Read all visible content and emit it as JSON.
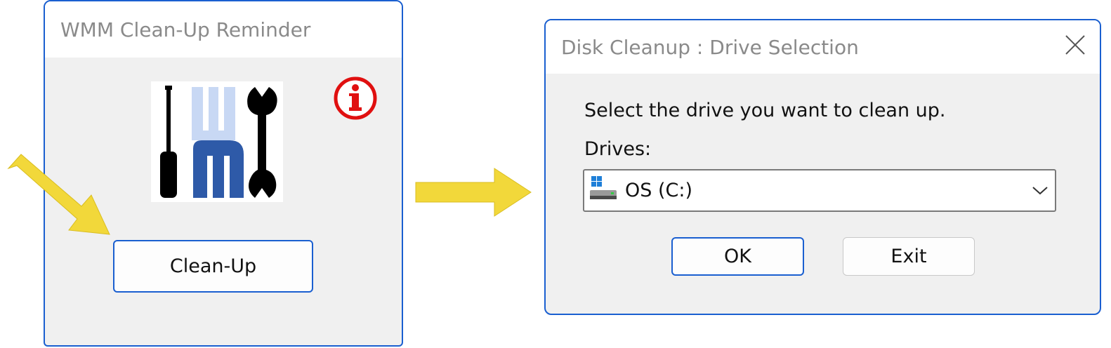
{
  "reminder_window": {
    "title": "WMM Clean-Up Reminder",
    "logo_icon": "wmm-tools-logo",
    "info_icon": "info-icon",
    "cleanup_button_label": "Clean-Up"
  },
  "disk_cleanup_window": {
    "title": "Disk Cleanup : Drive Selection",
    "close_icon": "close-icon",
    "prompt": "Select the drive you want to clean up.",
    "drives_label": "Drives:",
    "selected_drive": "OS (C:)",
    "drive_icon": "windows-drive-icon",
    "ok_label": "OK",
    "exit_label": "Exit"
  },
  "annotation_arrows": {
    "color": "#f2d83a",
    "icons": [
      "arrow-pointing-to-cleanup-button",
      "arrow-to-disk-cleanup-window"
    ]
  },
  "colors": {
    "accent_border": "#1a5fd0",
    "info_red": "#e01010",
    "logo_blue_dark": "#2e5aa8",
    "logo_blue_light": "#c8d8f4"
  }
}
